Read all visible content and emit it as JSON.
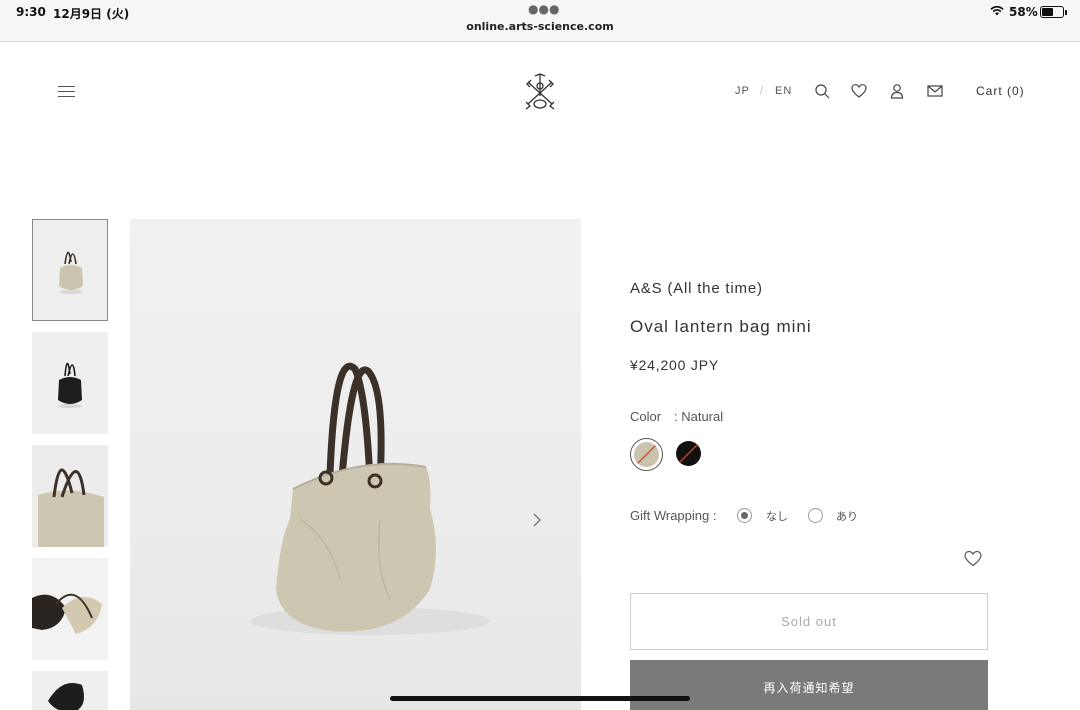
{
  "status_bar": {
    "time": "9:30",
    "date": "12月9日 (火)",
    "url": "online.arts-science.com",
    "battery_percent": "58%",
    "battery_level": 0.58
  },
  "header": {
    "lang_jp": "JP",
    "lang_sep": "/",
    "lang_en": "EN",
    "cart_label": "Cart (0)",
    "icons": [
      "menu-icon",
      "search-icon",
      "heart-icon",
      "user-icon",
      "mail-icon"
    ]
  },
  "product": {
    "brand": "A&S (All the time)",
    "name": "Oval lantern bag mini",
    "price": "¥24,200 JPY",
    "color_label": "Color",
    "color_value": ": Natural",
    "swatches": [
      {
        "name": "Natural",
        "color": "#c9c3ad",
        "selected": true,
        "sold_out": true
      },
      {
        "name": "Black",
        "color": "#111111",
        "selected": false,
        "sold_out": true
      }
    ],
    "gift_label": "Gift Wrapping :",
    "gift_options": [
      {
        "label": "なし",
        "checked": true
      },
      {
        "label": "あり",
        "checked": false
      }
    ],
    "sold_out_label": "Sold out",
    "restock_label": "再入荷通知希望"
  },
  "gallery": {
    "thumbnails": [
      "natural-bag-thumbnail",
      "black-bag-thumbnail",
      "natural-bag-closeup-thumbnail",
      "bag-handles-thumbnail",
      "black-bag-detail-thumbnail"
    ],
    "active_index": 0
  },
  "colors": {
    "natural": "#c9c3ad",
    "handle": "#3b3129",
    "button_gray": "#7a7a7a"
  }
}
